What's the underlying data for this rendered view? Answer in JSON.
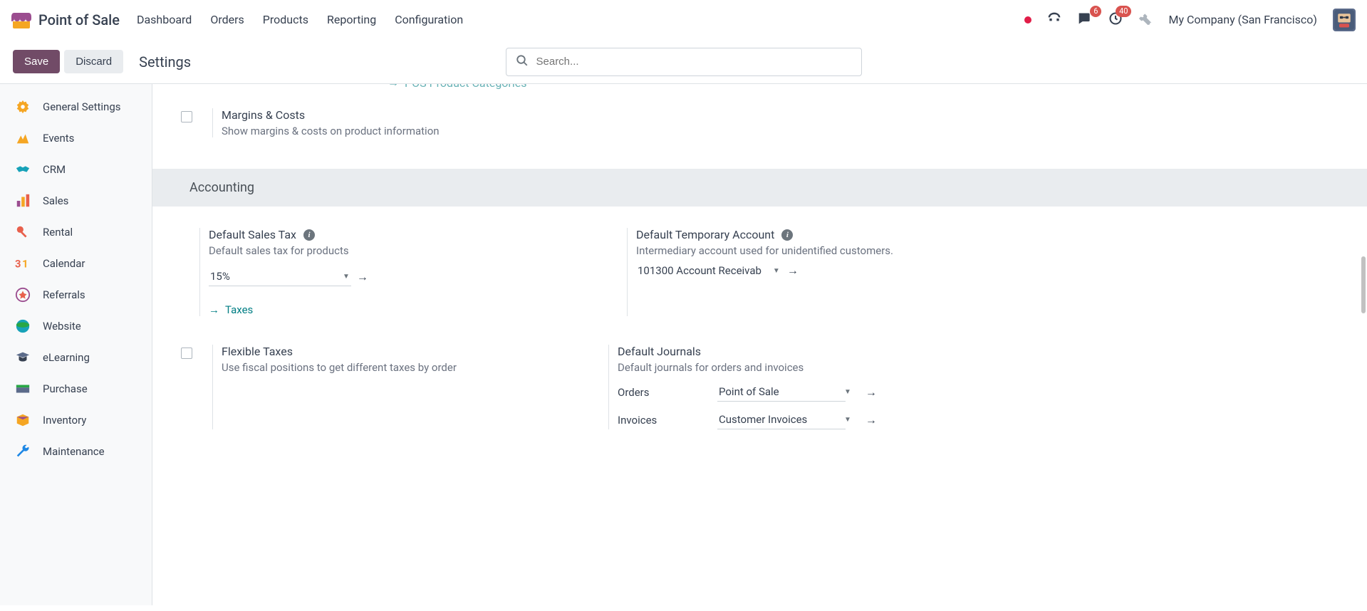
{
  "nav": {
    "brand": "Point of Sale",
    "menu": [
      "Dashboard",
      "Orders",
      "Products",
      "Reporting",
      "Configuration"
    ],
    "badge_messages": "6",
    "badge_activities": "40",
    "company": "My Company (San Francisco)"
  },
  "cp": {
    "save": "Save",
    "discard": "Discard",
    "title": "Settings",
    "search_placeholder": "Search..."
  },
  "sidebar": {
    "items": [
      {
        "label": "General Settings"
      },
      {
        "label": "Events"
      },
      {
        "label": "CRM"
      },
      {
        "label": "Sales"
      },
      {
        "label": "Rental"
      },
      {
        "label": "Calendar"
      },
      {
        "label": "Referrals"
      },
      {
        "label": "Website"
      },
      {
        "label": "eLearning"
      },
      {
        "label": "Purchase"
      },
      {
        "label": "Inventory"
      },
      {
        "label": "Maintenance"
      }
    ]
  },
  "content": {
    "partial_link": "POS Product Categories",
    "margins": {
      "title": "Margins & Costs",
      "desc": "Show margins & costs on product information"
    },
    "section_accounting": "Accounting",
    "default_tax": {
      "title": "Default Sales Tax",
      "desc": "Default sales tax for products",
      "value": "15%",
      "link": "Taxes"
    },
    "temp_account": {
      "title": "Default Temporary Account",
      "desc": "Intermediary account used for unidentified customers.",
      "value": "101300 Account Receivab"
    },
    "flex_tax": {
      "title": "Flexible Taxes",
      "desc": "Use fiscal positions to get different taxes by order"
    },
    "journals": {
      "title": "Default Journals",
      "desc": "Default journals for orders and invoices",
      "orders_label": "Orders",
      "orders_value": "Point of Sale",
      "invoices_label": "Invoices",
      "invoices_value": "Customer Invoices"
    }
  }
}
